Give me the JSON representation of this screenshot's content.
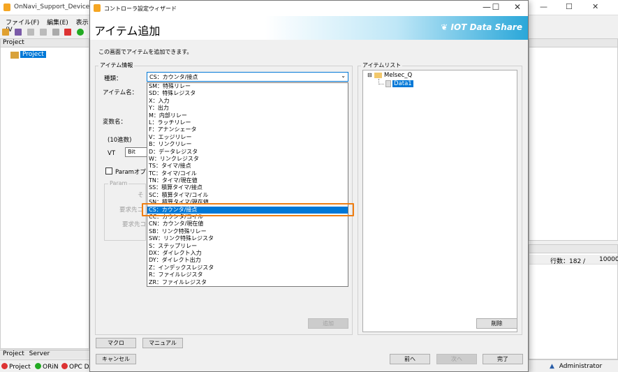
{
  "background": {
    "title": "OnNavi_Support_Device_PLC",
    "menu": [
      "ファイル(F)",
      "編集(E)",
      "表示(V"
    ],
    "project_header": "Project",
    "project_node": "Project",
    "bottom_tabs": [
      "Project",
      "Server"
    ],
    "status_items": [
      "Project",
      "ORiN",
      "OPC DA"
    ],
    "status_user": "Administrator",
    "rows_label": "行数：182 /",
    "rows_max": "10000"
  },
  "dialog": {
    "title": "コントローラ設定ウィザード",
    "header": "アイテム追加",
    "brand": "IOT Data Share",
    "description": "この画面でアイテムを追加できます。",
    "item_info_label": "アイテム情報",
    "type_label": "種類：",
    "type_value": "CS：カウンタ/接点",
    "item_name_label": "アイテム名：",
    "variable_name_label": "変数名：",
    "decimal_label": "(10進数)",
    "vt_label": "VT",
    "vt_value": "Bit",
    "param_option_label": "Paramオプシ",
    "param_group_label": "Param",
    "param_faded": [
      "そ",
      "要求先コ",
      "要求先コ"
    ],
    "add_button": "追加",
    "item_list_label": "アイテムリスト",
    "tree_root": "Melsec_Q",
    "tree_child": "Data1",
    "delete_button": "削除",
    "macro_button": "マクロ",
    "manual_button": "マニュアル",
    "cancel_button": "キャンセル",
    "prev_button": "前へ",
    "next_button": "次へ",
    "finish_button": "完了",
    "dropdown_options": [
      "SM：特殊リレー",
      "SD：特殊レジスタ",
      "X：入力",
      "Y：出力",
      "M：内部リレー",
      "L：ラッチリレー",
      "F：アナンシェータ",
      "V：エッジリレー",
      "B：リンクリレー",
      "D：データレジスタ",
      "W：リンクレジスタ",
      "TS：タイマ/接点",
      "TC：タイマ/コイル",
      "TN：タイマ/現在値",
      "SS：積算タイマ/接点",
      "SC：積算タイマ/コイル",
      "SN：積算タイマ/現在値",
      "CS：カウンタ/接点",
      "CC：カウンタ/コイル",
      "CN：カウンタ/現在値",
      "SB：リンク特殊リレー",
      "SW：リンク特殊レジスタ",
      "S：ステップリレー",
      "DX：ダイレクト入力",
      "DY：ダイレクト出力",
      "Z：インデックスレジスタ",
      "R：ファイルレジスタ",
      "ZR：ファイルレジスタ"
    ],
    "selected_index": 17
  },
  "colors": {
    "accent": "#0078d7",
    "highlight": "#f07e12",
    "brand_bg": "#2aa7d9"
  }
}
